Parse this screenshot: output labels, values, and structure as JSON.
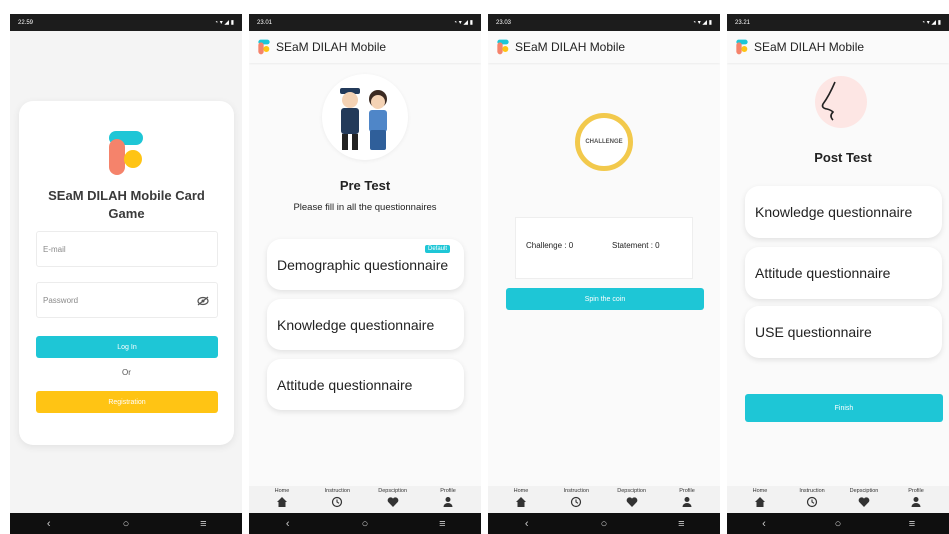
{
  "colors": {
    "accent": "#1ec6d6",
    "registration": "#ffc414",
    "logo_red": "#f5836b"
  },
  "status_times": [
    "22.59",
    "23.01",
    "23.03",
    "23.21"
  ],
  "app_title": "SEaM DILAH Mobile",
  "bottom_nav": {
    "home": "Home",
    "instruction": "Instruction",
    "description": "Depsciption",
    "profile": "Profile"
  },
  "login": {
    "title": "SEaM DILAH Mobile Card Game",
    "email_placeholder": "E-mail",
    "password_placeholder": "Password",
    "login_label": "Log In",
    "or_label": "Or",
    "registration_label": "Registration"
  },
  "pretest": {
    "title": "Pre Test",
    "subtitle": "Please fill in all the questionnaires",
    "badge": "Default",
    "items": [
      "Demographic questionnaire",
      "Knowledge questionnaire",
      "Attitude questionnaire"
    ]
  },
  "challenge": {
    "coin_label": "CHALLENGE",
    "challenge_label": "Challenge : 0",
    "statement_label": "Statement : 0",
    "spin_label": "Spin the coin"
  },
  "posttest": {
    "title": "Post Test",
    "items": [
      "Knowledge questionnaire",
      "Attitude questionnaire",
      "USE questionnaire"
    ],
    "finish_label": "Finish"
  }
}
